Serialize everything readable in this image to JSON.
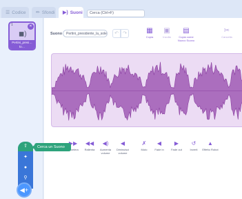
{
  "tabs": [
    {
      "label": "Codice",
      "icon": "code-icon"
    },
    {
      "label": "Sfondi",
      "icon": "brush-icon"
    },
    {
      "label": "Suoni",
      "icon": "speaker-icon"
    }
  ],
  "search": {
    "text": "Cerca (Ctrl+F)"
  },
  "sound_list": {
    "number": "1",
    "item_label": "Pertini_presi… to…"
  },
  "add_menu": {
    "tooltip": "Cerca un Suono",
    "items": [
      "upload-icon",
      "surprise-icon",
      "microphone-icon",
      "search-icon"
    ],
    "main_icon": "speaker-plus-icon"
  },
  "editor": {
    "name_label": "Suono",
    "sound_name": "Pertini_presidente_la_sole…",
    "tools": [
      {
        "label": "Copia",
        "icon": "copy-icon"
      },
      {
        "label": "Incolla",
        "icon": "paste-icon"
      },
      {
        "label": "Copia come Nuovo Suono",
        "icon": "copy-new-icon"
      },
      {
        "label": "Cancella",
        "icon": "scissors-icon"
      }
    ],
    "effects": [
      {
        "label": "Accelera",
        "icon": "fast-icon"
      },
      {
        "label": "Rallenta",
        "icon": "slow-icon"
      },
      {
        "label": "Aumenta volume",
        "icon": "louder-icon"
      },
      {
        "label": "Diminuisci volume",
        "icon": "softer-icon"
      },
      {
        "label": "Muto",
        "icon": "mute-icon"
      },
      {
        "label": "Fade in",
        "icon": "fade-in-icon"
      },
      {
        "label": "Fade out",
        "icon": "fade-out-icon"
      },
      {
        "label": "Inverti",
        "icon": "reverse-icon"
      },
      {
        "label": "Effetto Robot",
        "icon": "robot-icon"
      }
    ]
  },
  "colors": {
    "accent": "#855cd6",
    "waveform": "#a05ab4",
    "waveform_bg": "#ecdcf4",
    "tooltip": "#2ea37c",
    "menu": "#3a76d8"
  }
}
